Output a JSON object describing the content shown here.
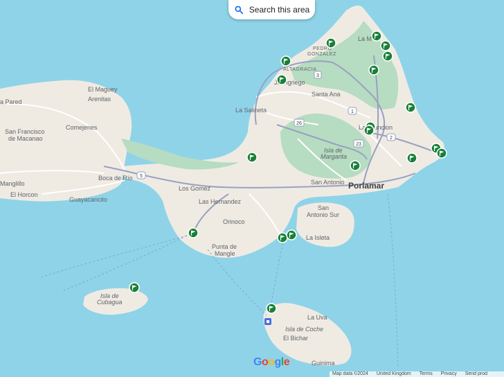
{
  "search_button": {
    "label": "Search this area",
    "icon": "search-icon"
  },
  "labels": [
    {
      "id": "el-maguey",
      "text": "El Maguey"
    },
    {
      "id": "arenitas",
      "text": "Arenitas"
    },
    {
      "id": "la-pared",
      "text": "a Pared"
    },
    {
      "id": "san-francisco",
      "text": "San Francisco"
    },
    {
      "id": "de-macanao",
      "text": "de Macanao"
    },
    {
      "id": "comejenes",
      "text": "Comejenes"
    },
    {
      "id": "boca-de-rio",
      "text": "Boca de Río"
    },
    {
      "id": "manglillo",
      "text": "Manglillo"
    },
    {
      "id": "el-horcon",
      "text": "El Horcon"
    },
    {
      "id": "guayacancito",
      "text": "Guayacancito"
    },
    {
      "id": "los-gomez",
      "text": "Los Gomez"
    },
    {
      "id": "las-hernandez",
      "text": "Las Hernandez"
    },
    {
      "id": "orinoco",
      "text": "Orinoco"
    },
    {
      "id": "punta-de",
      "text": "Punta de"
    },
    {
      "id": "mangle",
      "text": "Mangle"
    },
    {
      "id": "la-salineta",
      "text": "La Salineta"
    },
    {
      "id": "santa-ana",
      "text": "Santa Ana"
    },
    {
      "id": "juan-griego",
      "text": "Juangriego"
    },
    {
      "id": "pedro",
      "text": "PEDRO"
    },
    {
      "id": "gonzalez",
      "text": "GONZALEZ"
    },
    {
      "id": "altagracia",
      "text": "ALTAGRACIA"
    },
    {
      "id": "la-m",
      "text": "La M"
    },
    {
      "id": "la-asuncion",
      "text": "La Asuncion"
    },
    {
      "id": "isla-de",
      "text": "Isla de"
    },
    {
      "id": "margarita",
      "text": "Margarita"
    },
    {
      "id": "san-antonio",
      "text": "San Antonio"
    },
    {
      "id": "porlamar",
      "text": "Porlamar"
    },
    {
      "id": "san",
      "text": "San"
    },
    {
      "id": "antonio-sur",
      "text": "Antonio Sur"
    },
    {
      "id": "la-isleta",
      "text": "La Isleta"
    },
    {
      "id": "isla-de-cubagua-1",
      "text": "Isla de"
    },
    {
      "id": "isla-de-cubagua-2",
      "text": "Cubagua"
    },
    {
      "id": "la-uva",
      "text": "La Uva"
    },
    {
      "id": "isla-de-coche",
      "text": "Isla de Coche"
    },
    {
      "id": "el-bichar",
      "text": "El Bichar"
    },
    {
      "id": "guinima",
      "text": "Guinima"
    }
  ],
  "route_shields": [
    "3",
    "1",
    "26",
    "23",
    "2",
    "5"
  ],
  "pin_icon": "flag-pin-icon",
  "pin_color": "#188038",
  "google_logo": "Google",
  "attribution": {
    "map_data": "Map data ©2024",
    "region": "United Kingdom",
    "terms": "Terms",
    "privacy": "Privacy",
    "feedback": "Send prod"
  },
  "colors": {
    "water": "#8fd3e8",
    "land": "#efebe3",
    "park": "#b6dcc2",
    "road": "#ffffff",
    "major_road": "#9aa0c0"
  }
}
